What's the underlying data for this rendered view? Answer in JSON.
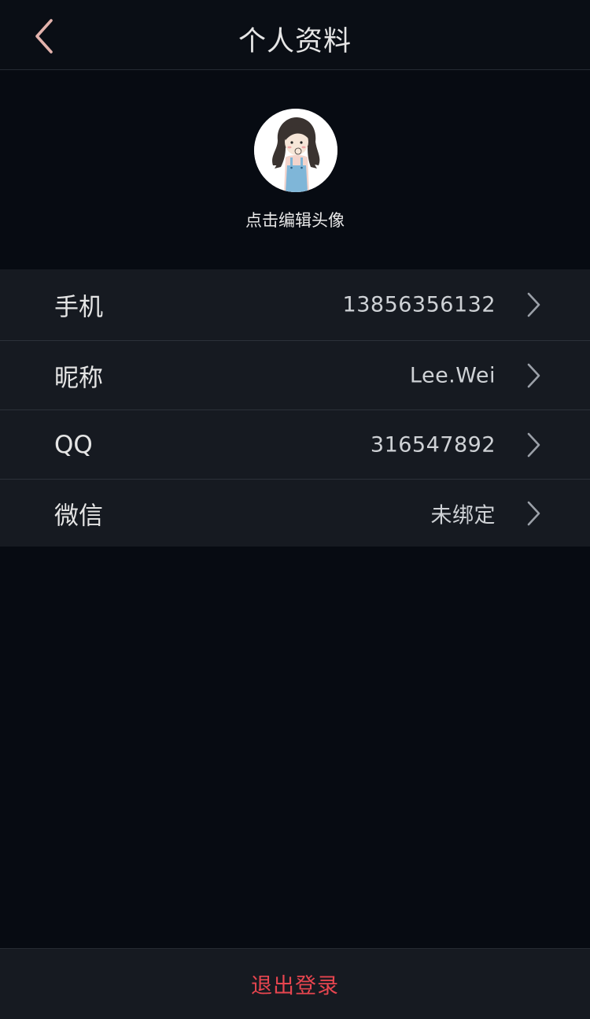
{
  "header": {
    "title": "个人资料"
  },
  "avatar": {
    "caption": "点击编辑头像"
  },
  "profile_rows": [
    {
      "label": "手机",
      "value": "13856356132"
    },
    {
      "label": "昵称",
      "value": "Lee.Wei"
    },
    {
      "label": "QQ",
      "value": "316547892"
    },
    {
      "label": "微信",
      "value": "未绑定"
    }
  ],
  "logout": {
    "label": "退出登录"
  },
  "icons": {
    "back": "chevron-left-icon",
    "row_arrow": "chevron-right-icon"
  },
  "colors": {
    "back_arrow": "#e3b3ad",
    "logout_text": "#e6454f"
  }
}
